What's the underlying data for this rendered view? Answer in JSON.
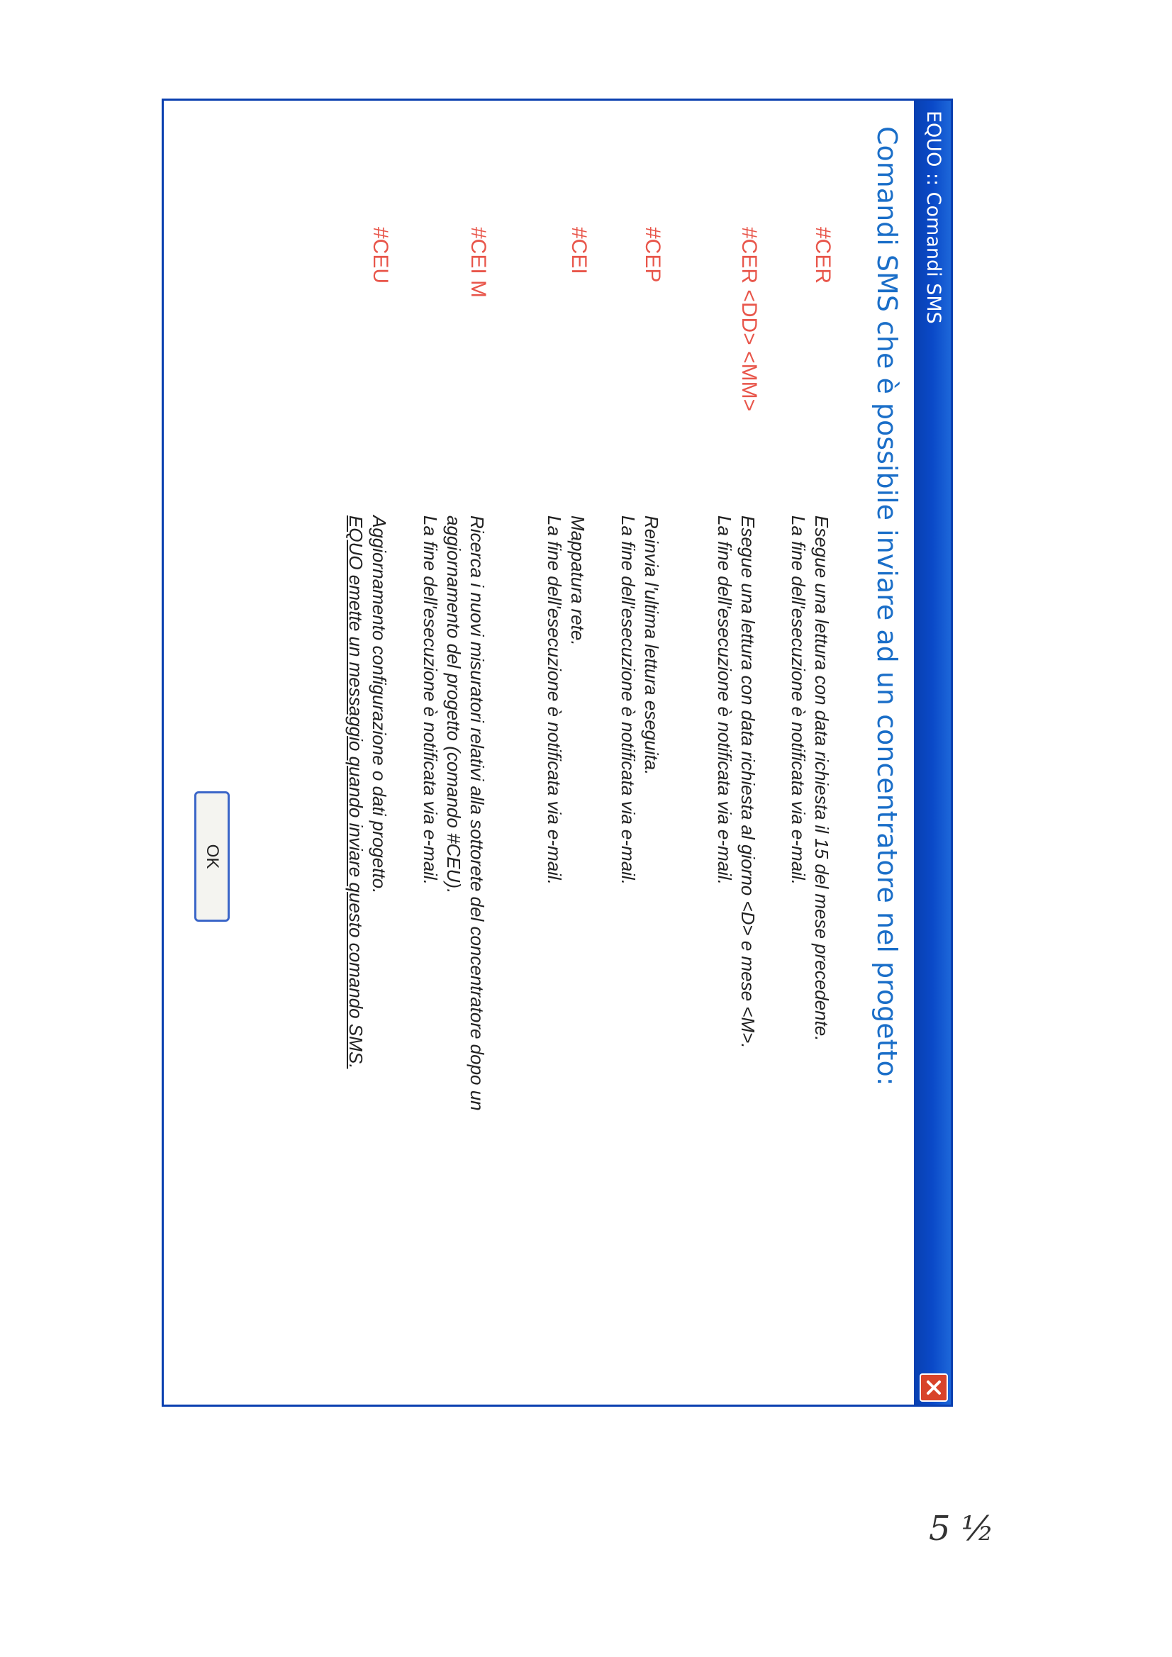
{
  "window": {
    "title": "EQUO :: Comandi SMS",
    "heading": "Comandi SMS che è possibile inviare ad un concentratore nel progetto:"
  },
  "commands": [
    {
      "command": "#CER",
      "lines": [
        "Esegue una lettura con data richiesta il 15 del mese precedente.",
        "La fine dell'esecuzione è notificata via e-mail."
      ]
    },
    {
      "command": "#CER <DD> <MM>",
      "lines": [
        "Esegue una lettura con data richiesta al giorno <D> e mese <M>.",
        "La fine dell'esecuzione è notificata via e-mail."
      ]
    },
    {
      "command": "#CEP",
      "lines": [
        "Reinvia l'ultima lettura eseguita.",
        "La fine dell'esecuzione è notificata via e-mail."
      ]
    },
    {
      "command": "#CEI",
      "lines": [
        "Mappatura rete.",
        "La fine dell'esecuzione è notificata via e-mail."
      ]
    },
    {
      "command": "#CEI M",
      "lines": [
        "Ricerca i nuovi misuratori relativi alla sottorete del concentratore dopo un",
        "aggiornamento del progetto (comando #CEU).",
        "La fine dell'esecuzione è notificata via e-mail."
      ]
    },
    {
      "command": "#CEU",
      "lines": [
        "Aggiornamento configurazione o dati progetto.",
        "EQUO emette un messaggio quando inviare questo comando SMS."
      ]
    }
  ],
  "buttons": {
    "ok": "OK"
  },
  "handwritten_note": "5 ½"
}
